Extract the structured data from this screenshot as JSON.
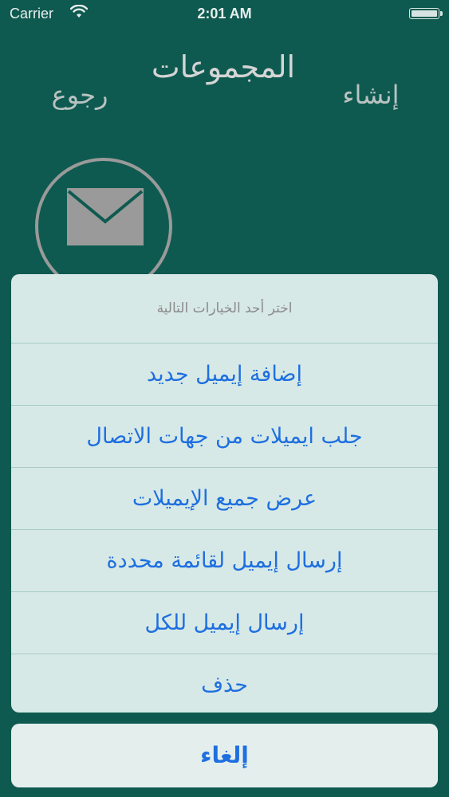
{
  "status_bar": {
    "carrier": "Carrier",
    "time": "2:01 AM"
  },
  "nav": {
    "title": "المجموعات",
    "back_label": "رجوع",
    "create_label": "إنشاء"
  },
  "icons": {
    "mail": "mail-icon",
    "wifi": "wifi-icon",
    "battery": "battery-icon"
  },
  "action_sheet": {
    "title": "اختر أحد الخيارات التالية",
    "options": [
      "إضافة إيميل جديد",
      "جلب ايميلات من جهات الاتصال",
      "عرض جميع الإيميلات",
      "إرسال إيميل لقائمة محددة",
      "إرسال إيميل للكل",
      "حذف"
    ],
    "cancel_label": "إلغاء"
  },
  "colors": {
    "background": "#0f5a50",
    "sheet": "#d7e9e6",
    "action_text": "#1e6fe0"
  }
}
